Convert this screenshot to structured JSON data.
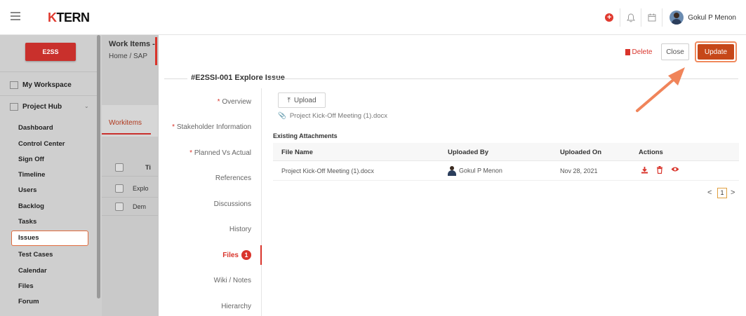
{
  "header": {
    "logo_k": "K",
    "logo_rest": "TERN",
    "user_name": "Gokul P Menon"
  },
  "sidebar": {
    "workspace_badge": "E2SS",
    "my_workspace": "My Workspace",
    "project_hub": "Project Hub",
    "items": [
      "Dashboard",
      "Control Center",
      "Sign Off",
      "Timeline",
      "Users",
      "Backlog",
      "Tasks",
      "Issues",
      "Test Cases",
      "Calendar",
      "Files",
      "Forum"
    ],
    "active_item": "Issues"
  },
  "background_page": {
    "title": "Work Items -",
    "breadcrumb": "Home  /  SAP",
    "tab": "Workitems",
    "column": "Ti",
    "rows": [
      "Explo",
      "Dem"
    ]
  },
  "modal": {
    "title": "#E2SSI-001 Explore Issue",
    "buttons": {
      "delete": "Delete",
      "close": "Close",
      "update": "Update"
    },
    "nav": [
      {
        "label": "Overview",
        "required": "* "
      },
      {
        "label": "Stakeholder Information",
        "required": "* "
      },
      {
        "label": "Planned Vs Actual",
        "required": "* "
      },
      {
        "label": "References",
        "required": ""
      },
      {
        "label": "Discussions",
        "required": ""
      },
      {
        "label": "History",
        "required": ""
      },
      {
        "label": "Files",
        "required": "",
        "badge": "1"
      },
      {
        "label": "Wiki / Notes",
        "required": ""
      },
      {
        "label": "Hierarchy",
        "required": ""
      }
    ],
    "upload_label": "Upload",
    "new_attachment": "Project Kick-Off Meeting (1).docx",
    "existing_label": "Existing Attachments",
    "table": {
      "columns": [
        "File Name",
        "Uploaded By",
        "Uploaded On",
        "Actions"
      ],
      "rows": [
        {
          "file_name": "Project Kick-Off Meeting (1).docx",
          "uploaded_by": "Gokul P Menon",
          "uploaded_on": "Nov 28, 2021"
        }
      ]
    },
    "pager": {
      "prev": "<",
      "page": "1",
      "next": ">"
    }
  },
  "icons": {
    "menu": "hamburger-icon",
    "add": "plus-circle-icon",
    "notifications": "bell-icon",
    "calendar": "calendar-icon",
    "download": "download-icon",
    "delete": "trash-icon",
    "view": "eye-icon"
  },
  "colors": {
    "brand_red": "#d9342b",
    "update_button": "#c64719",
    "highlight": "#f08a5d"
  }
}
